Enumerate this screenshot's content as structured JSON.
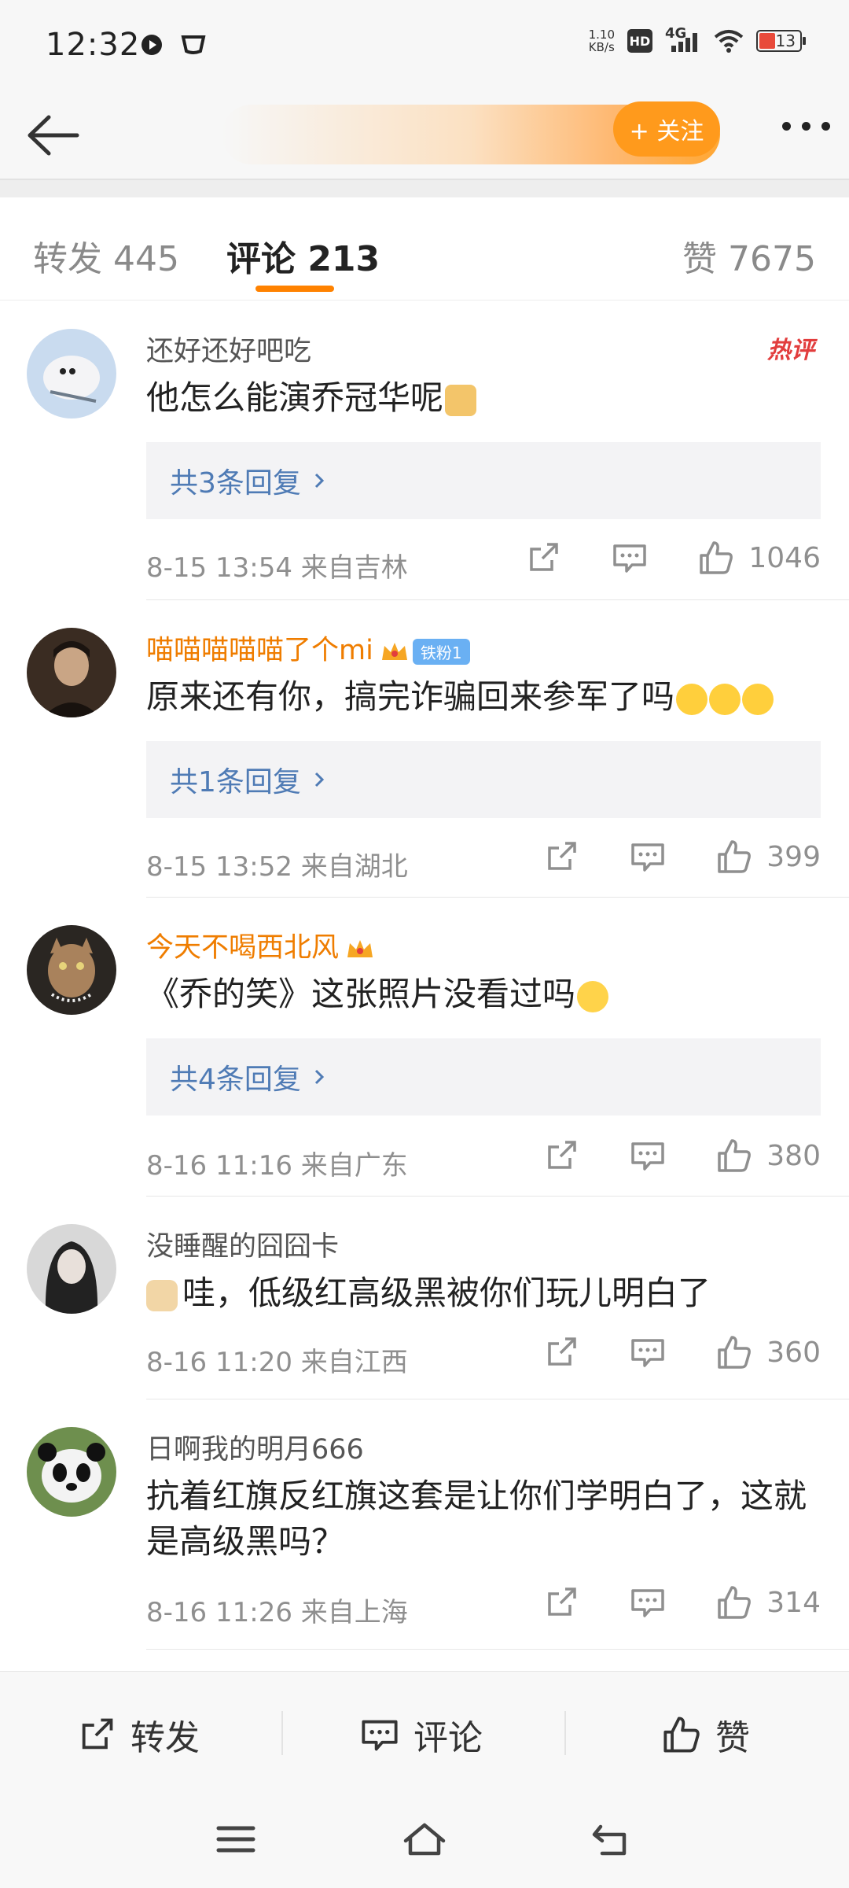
{
  "status_bar": {
    "time": "12:32",
    "net_speed_value": "1.10",
    "net_speed_unit": "KB/s",
    "hd": "HD",
    "network": "4G",
    "battery": "13"
  },
  "nav": {
    "follow_label": "+ 关注"
  },
  "tabs": {
    "repost": "转发 445",
    "comments": "评论 213",
    "likes": "赞 7675"
  },
  "comments": [
    {
      "username": "还好还好吧吃",
      "text": "他怎么能演乔冠华呢",
      "badge": "热评",
      "replies": "共3条回复",
      "meta": "8-15 13:54 来自吉林",
      "likes": "1046"
    },
    {
      "username": "喵喵喵喵喵了个mi",
      "fan_badge": "铁粉1",
      "text": "原来还有你，搞完诈骗回来参军了吗",
      "replies": "共1条回复",
      "meta": "8-15 13:52 来自湖北",
      "likes": "399"
    },
    {
      "username": "今天不喝西北风",
      "text": "《乔的笑》这张照片没看过吗",
      "replies": "共4条回复",
      "meta": "8-16 11:16 来自广东",
      "likes": "380"
    },
    {
      "username": "没睡醒的囧囧卡",
      "text": "哇，低级红高级黑被你们玩儿明白了",
      "meta": "8-16 11:20 来自江西",
      "likes": "360"
    },
    {
      "username": "日啊我的明月666",
      "text": "抗着红旗反红旗这套是让你们学明白了，这就是高级黑吗？",
      "meta": "8-16 11:26 来自上海",
      "likes": "314"
    }
  ],
  "bottom_bar": {
    "repost": "转发",
    "comment": "评论",
    "like": "赞"
  },
  "colors": {
    "accent_orange": "#ff8200",
    "follow_button": "#ff9a1c",
    "username_orange": "#ef7d00",
    "reply_link": "#4f7bb5",
    "hot_badge": "#e23d3d"
  },
  "icons": [
    "back-arrow-icon",
    "more-icon",
    "share-icon",
    "comment-icon",
    "like-icon",
    "chevron-right-icon",
    "crown-icon",
    "menu-icon",
    "home-icon",
    "return-icon"
  ]
}
